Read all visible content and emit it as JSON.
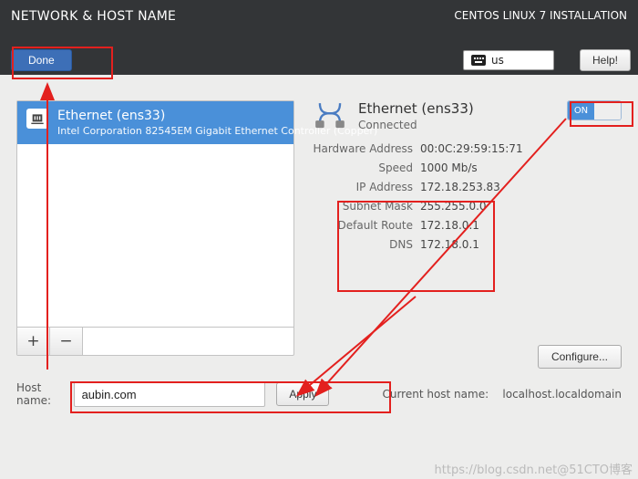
{
  "header": {
    "title": "NETWORK & HOST NAME",
    "product": "CENTOS LINUX 7 INSTALLATION",
    "done_label": "Done",
    "lang": "us",
    "help_label": "Help!"
  },
  "nic_list": {
    "selected": {
      "title": "Ethernet (ens33)",
      "subtitle": "Intel Corporation 82545EM Gigabit Ethernet Controller (Copper)"
    },
    "add_label": "+",
    "remove_label": "−"
  },
  "detail": {
    "title": "Ethernet (ens33)",
    "status": "Connected",
    "toggle_state": "ON",
    "rows": {
      "hw_label": "Hardware Address",
      "hw_value": "00:0C:29:59:15:71",
      "speed_label": "Speed",
      "speed_value": "1000 Mb/s",
      "ip_label": "IP Address",
      "ip_value": "172.18.253.83",
      "mask_label": "Subnet Mask",
      "mask_value": "255.255.0.0",
      "route_label": "Default Route",
      "route_value": "172.18.0.1",
      "dns_label": "DNS",
      "dns_value": "172.18.0.1"
    },
    "configure_label": "Configure..."
  },
  "host": {
    "label": "Host name:",
    "value": "aubin.com",
    "apply_label": "Apply",
    "current_label": "Current host name:",
    "current_value": "localhost.localdomain"
  },
  "watermark": "https://blog.csdn.net@51CTO博客"
}
